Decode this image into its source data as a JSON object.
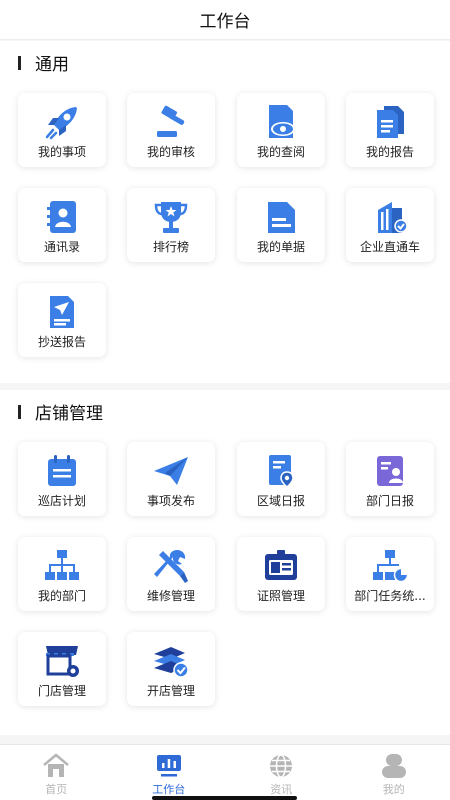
{
  "header": {
    "title": "工作台"
  },
  "sections": [
    {
      "title": "通用",
      "items": [
        {
          "label": "我的事项",
          "icon": "rocket-icon"
        },
        {
          "label": "我的审核",
          "icon": "gavel-icon"
        },
        {
          "label": "我的查阅",
          "icon": "document-eye-icon"
        },
        {
          "label": "我的报告",
          "icon": "report-icon"
        },
        {
          "label": "通讯录",
          "icon": "contacts-icon"
        },
        {
          "label": "排行榜",
          "icon": "trophy-icon"
        },
        {
          "label": "我的单据",
          "icon": "receipt-icon"
        },
        {
          "label": "企业直通车",
          "icon": "building-icon"
        },
        {
          "label": "抄送报告",
          "icon": "paper-plane-document-icon"
        }
      ]
    },
    {
      "title": "店铺管理",
      "items": [
        {
          "label": "巡店计划",
          "icon": "calendar-icon"
        },
        {
          "label": "事项发布",
          "icon": "paper-plane-icon"
        },
        {
          "label": "区域日报",
          "icon": "location-document-icon"
        },
        {
          "label": "部门日报",
          "icon": "person-document-icon"
        },
        {
          "label": "我的部门",
          "icon": "org-chart-icon"
        },
        {
          "label": "维修管理",
          "icon": "tools-icon"
        },
        {
          "label": "证照管理",
          "icon": "id-card-icon"
        },
        {
          "label": "部门任务统...",
          "icon": "task-stats-icon"
        },
        {
          "label": "门店管理",
          "icon": "store-settings-icon"
        },
        {
          "label": "开店管理",
          "icon": "open-store-icon"
        }
      ]
    }
  ],
  "tabbar": [
    {
      "label": "首页",
      "icon": "home-icon",
      "active": false
    },
    {
      "label": "工作台",
      "icon": "workbench-icon",
      "active": true
    },
    {
      "label": "资讯",
      "icon": "globe-icon",
      "active": false
    },
    {
      "label": "我的",
      "icon": "profile-icon",
      "active": false
    }
  ],
  "colors": {
    "accent": "#2e6bd6",
    "icon_blue": "#3b7fe6",
    "inactive": "#b5b5b5",
    "purple": "#7b68d8"
  }
}
